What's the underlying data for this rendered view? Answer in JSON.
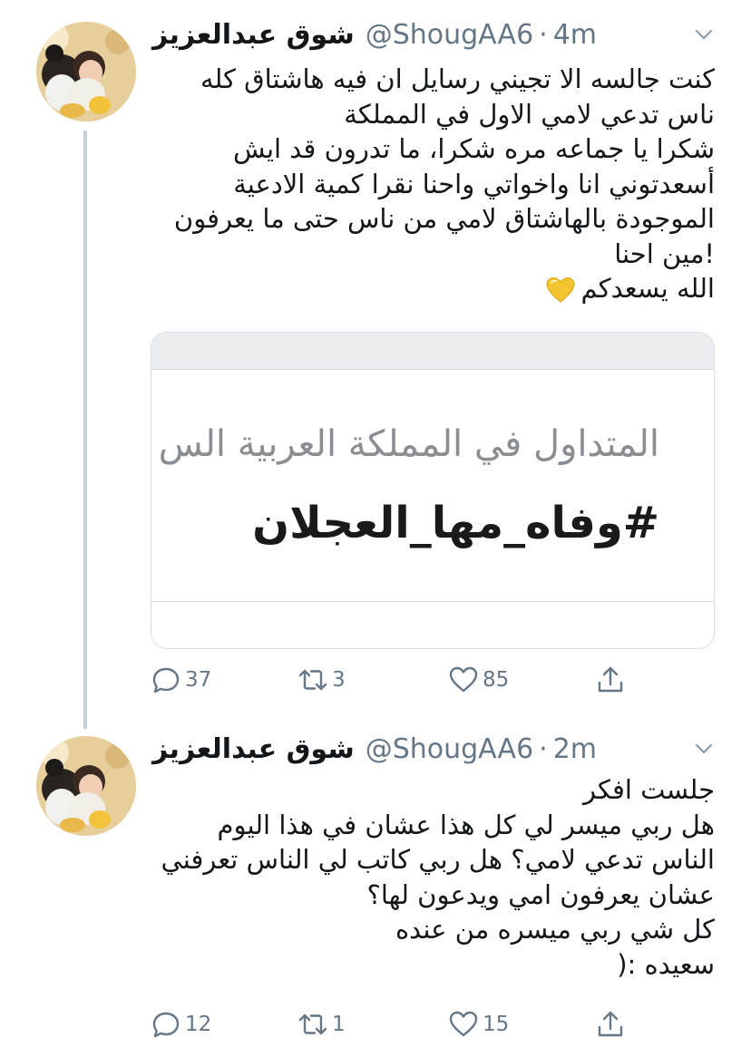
{
  "tweets": [
    {
      "display_name": "شوق عبدالعزيز",
      "handle": "@ShougAA6",
      "separator": "·",
      "time": "4m",
      "lines": [
        "كنت جالسه الا تجيني رسايل ان فيه هاشتاق كله",
        "ناس تدعي لامي الاول في المملكة",
        "شكرا يا جماعه مره شكرا، ما تدرون قد ايش",
        "أسعدتوني انا واخواتي واحنا نقرا كمية الادعية",
        "الموجودة بالهاشتاق لامي من ناس حتى ما يعرفون",
        "!مين احنا",
        "الله يسعدكم"
      ],
      "emoji_icon": "yellow-heart-icon",
      "card": {
        "subtitle": "المتداول في المملكة العربية الس",
        "hashtag": "#وفاه_مها_العجلان"
      },
      "reply_count": "37",
      "retweet_count": "3",
      "like_count": "85"
    },
    {
      "display_name": "شوق عبدالعزيز",
      "handle": "@ShougAA6",
      "separator": "·",
      "time": "2m",
      "lines": [
        "جلست افكر",
        "هل ربي ميسر لي كل هذا عشان في هذا اليوم",
        "الناس تدعي لامي؟ هل ربي كاتب لي الناس تعرفني",
        "عشان يعرفون امي ويدعون لها؟",
        "كل شي ربي ميسره من عنده",
        "سعيده :("
      ],
      "reply_count": "12",
      "retweet_count": "1",
      "like_count": "15"
    }
  ],
  "colors": {
    "text": "#14171a",
    "muted": "#657786",
    "thread_line": "#c4cfd6",
    "border": "#d8dee3"
  }
}
